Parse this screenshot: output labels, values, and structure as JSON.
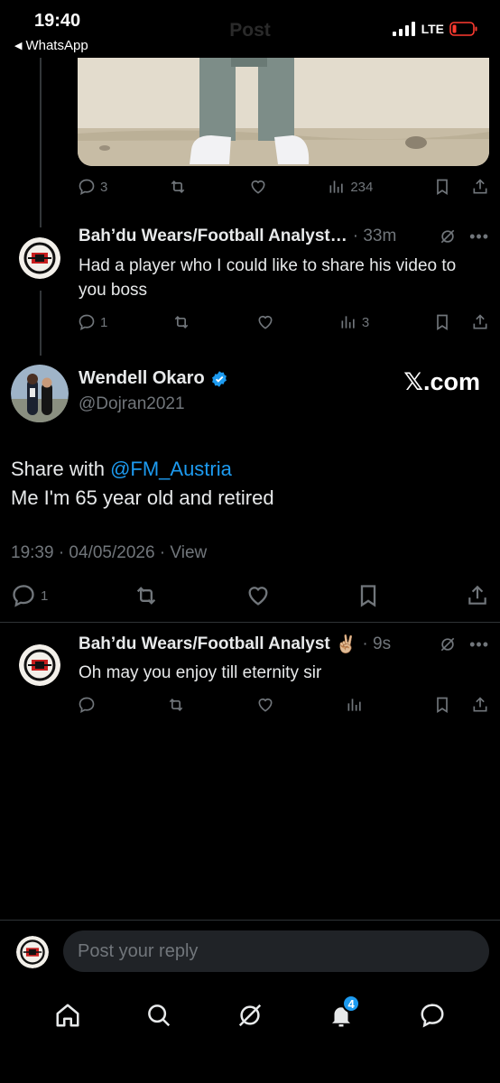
{
  "status_bar": {
    "time": "19:40",
    "back_app": "WhatsApp",
    "network": "LTE",
    "faded_title": "Post"
  },
  "tweet_prev_actions": {
    "replies": "3",
    "views": "234"
  },
  "reply1": {
    "name": "Bah’du Wears/Football Analyst…",
    "time": "· 33m",
    "text": "Had a player who I could like to share his video to you boss",
    "replies": "1",
    "views": "3"
  },
  "main_tweet": {
    "name": "Wendell Okaro",
    "handle": "@Dojran2021",
    "source": "𝕏.com",
    "text_prefix": "Share with ",
    "mention": "@FM_Austria",
    "text_line2": "Me I'm 65 year old and retired",
    "timestamp": "19:39 · 04/05/2026 · ",
    "view_label": "View",
    "replies": "1"
  },
  "reply2": {
    "name": "Bah’du Wears/Football Analyst",
    "emoji": "✌🏼",
    "time": "· 9s",
    "text": "Oh may you enjoy till eternity sir"
  },
  "composer": {
    "placeholder": "Post your reply"
  },
  "tab_bar": {
    "notification_count": "4"
  },
  "colors": {
    "accent": "#1d9bf0",
    "muted": "#71767b",
    "background": "#000000"
  }
}
